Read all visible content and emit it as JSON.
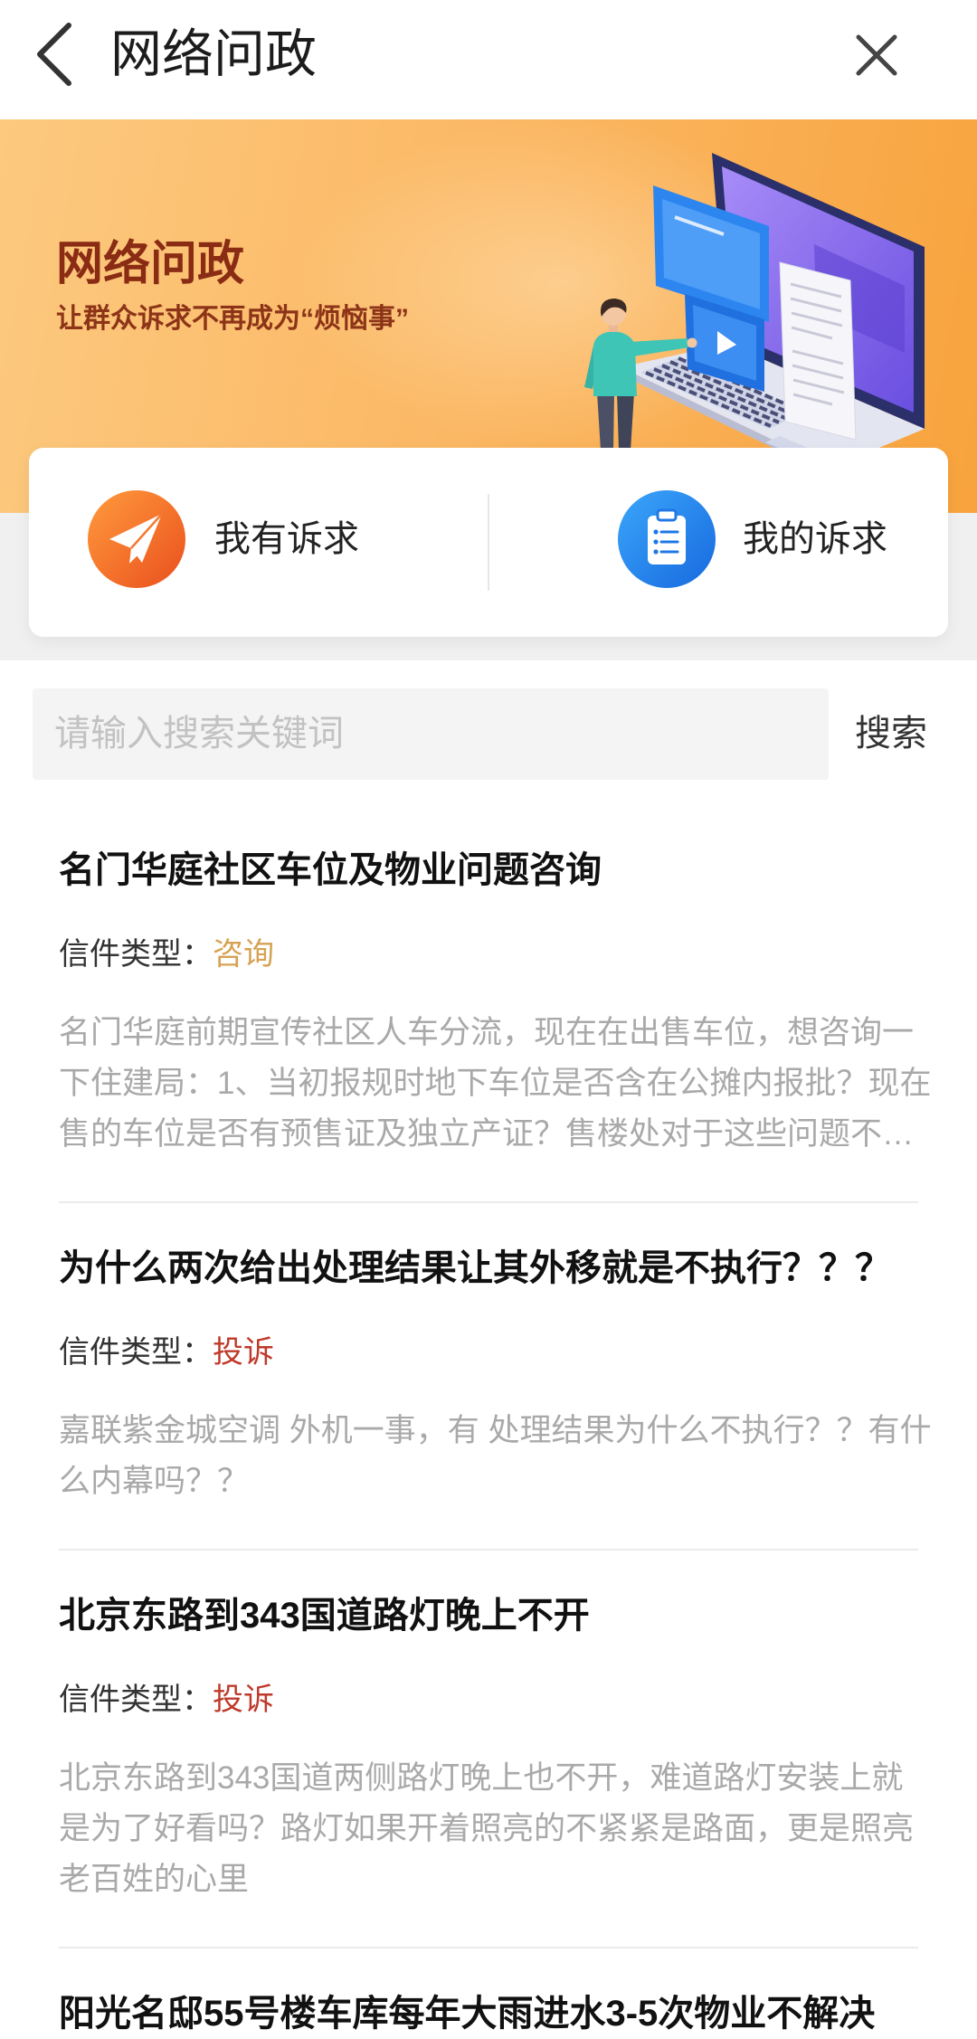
{
  "header": {
    "title": "网络问政",
    "back_icon": "chevron-left-icon",
    "close_icon": "close-icon"
  },
  "banner": {
    "title": "网络问政",
    "subtitle": "让群众诉求不再成为“烦恼事”"
  },
  "actions": [
    {
      "label": "我有诉求",
      "icon": "paper-plane-icon",
      "color": "#f26a25"
    },
    {
      "label": "我的诉求",
      "icon": "clipboard-list-icon",
      "color": "#1f7be6"
    }
  ],
  "search": {
    "value": "",
    "placeholder": "请输入搜索关键词",
    "button_label": "搜索"
  },
  "list": {
    "type_label": "信件类型：",
    "items": [
      {
        "title": "名门华庭社区车位及物业问题咨询",
        "type": "咨询",
        "type_color": "#d6a253",
        "description_lines": [
          "名门华庭前期宣传社区人车分流，现在在出售车位，想咨询一",
          "下住建局：1、当初报规时地下车位是否含在公摊内报批？现在",
          "售的车位是否有预售证及独立产证？售楼处对于这些问题不…"
        ]
      },
      {
        "title": "为什么两次给出处理结果让其外移就是不执行？？？",
        "type": "投诉",
        "type_color": "#bf3a2b",
        "description_lines": [
          "嘉联紫金城空调 外机一事，有 处理结果为什么不执行？？有什",
          "么内幕吗？？"
        ]
      },
      {
        "title": "北京东路到343国道路灯晚上不开",
        "type": "投诉",
        "type_color": "#bf3a2b",
        "description_lines": [
          "北京东路到343国道两侧路灯晚上也不开，难道路灯安装上就",
          "是为了好看吗？路灯如果开着照亮的不紧紧是路面，更是照亮",
          "老百姓的心里"
        ]
      },
      {
        "title": "阳光名邸55号楼车库每年大雨进水3-5次物业不解决"
      }
    ]
  },
  "colors": {
    "banner_title": "#8a2b14",
    "consult": "#d6a253",
    "complaint": "#bf3a2b",
    "description_text": "#a9a9a9",
    "search_background": "#f4f4f4"
  }
}
